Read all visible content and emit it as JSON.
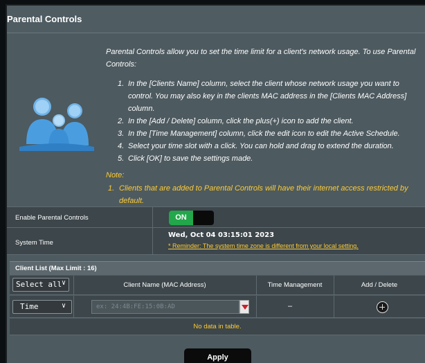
{
  "header": {
    "title": "Parental Controls"
  },
  "intro": {
    "description": "Parental Controls allow you to set the time limit for a client's network usage. To use Parental Controls:",
    "steps": [
      {
        "num": "1.",
        "text": "In the [Clients Name] column, select the client whose network usage you want to control. You may also key in the clients MAC address in the [Clients MAC Address] column."
      },
      {
        "num": "2.",
        "text": "In the [Add / Delete] column, click the plus(+) icon to add the client."
      },
      {
        "num": "3.",
        "text": "In the [Time Management] column, click the edit icon to edit the Active Schedule."
      },
      {
        "num": "4.",
        "text": "Select your time slot with a click. You can hold and drag to extend the duration."
      },
      {
        "num": "5.",
        "text": "Click [OK] to save the settings made."
      }
    ],
    "note_label": "Note:",
    "note": {
      "num": "1.",
      "text": "Clients that are added to Parental Controls will have their internet access restricted by default."
    },
    "icon": "family-icon"
  },
  "settings": {
    "enable_label": "Enable Parental Controls",
    "toggle_state": "ON",
    "system_time_label": "System Time",
    "system_time_value": "Wed, Oct 04 03:15:01 2023",
    "reminder": "* Reminder: The system time zone is different from your local setting."
  },
  "client_list": {
    "title": "Client List (Max Limit : 16)",
    "filter_select": "Select all",
    "columns": [
      "Client Name (MAC Address)",
      "Time Management",
      "Add / Delete"
    ],
    "input_row": {
      "time_select": "Time",
      "mac_placeholder": "ex: 24:4B:FE:15:0B:AD",
      "time_mgmt": "–",
      "add_icon": "plus-circle-icon"
    },
    "empty_text": "No data in table."
  },
  "apply_label": "Apply",
  "colors": {
    "accent_on": "#22a74a",
    "warning": "#ffcc33",
    "panel": "#4d5a60",
    "row": "#3c464b"
  }
}
